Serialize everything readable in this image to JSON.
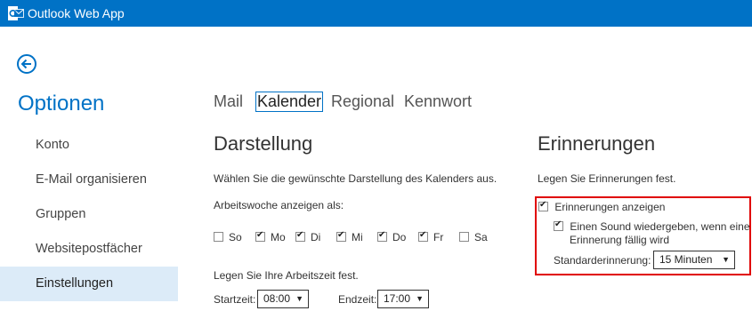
{
  "app": {
    "title": "Outlook Web App",
    "logo_icon": "outlook-logo-icon"
  },
  "brand_color": "#0072c6",
  "sidebar": {
    "title": "Optionen",
    "items": [
      {
        "label": "Konto",
        "active": false
      },
      {
        "label": "E-Mail organisieren",
        "active": false
      },
      {
        "label": "Gruppen",
        "active": false
      },
      {
        "label": "Websitepostfächer",
        "active": false
      },
      {
        "label": "Einstellungen",
        "active": true
      }
    ]
  },
  "tabs": [
    {
      "label": "Mail",
      "selected": false
    },
    {
      "label": "Kalender",
      "selected": true
    },
    {
      "label": "Regional",
      "selected": false
    },
    {
      "label": "Kennwort",
      "selected": false
    }
  ],
  "display": {
    "title": "Darstellung",
    "description": "Wählen Sie die gewünschte Darstellung des Kalenders aus.",
    "workweek_label": "Arbeitswoche anzeigen als:",
    "days": [
      {
        "label": "So",
        "checked": false
      },
      {
        "label": "Mo",
        "checked": true
      },
      {
        "label": "Di",
        "checked": true
      },
      {
        "label": "Mi",
        "checked": true
      },
      {
        "label": "Do",
        "checked": true
      },
      {
        "label": "Fr",
        "checked": true
      },
      {
        "label": "Sa",
        "checked": false
      }
    ],
    "worktime_label": "Legen Sie Ihre Arbeitszeit fest.",
    "start_label": "Startzeit:",
    "start_value": "08:00",
    "end_label": "Endzeit:",
    "end_value": "17:00"
  },
  "reminders": {
    "title": "Erinnerungen",
    "description": "Legen Sie Erinnerungen fest.",
    "show_label": "Erinnerungen anzeigen",
    "show_checked": true,
    "sound_label_line1": "Einen Sound wiedergeben, wenn eine",
    "sound_label_line2": "Erinnerung fällig wird",
    "sound_checked": true,
    "default_label": "Standarderinnerung:",
    "default_value": "15 Minuten"
  },
  "highlight_color": "#e00000"
}
